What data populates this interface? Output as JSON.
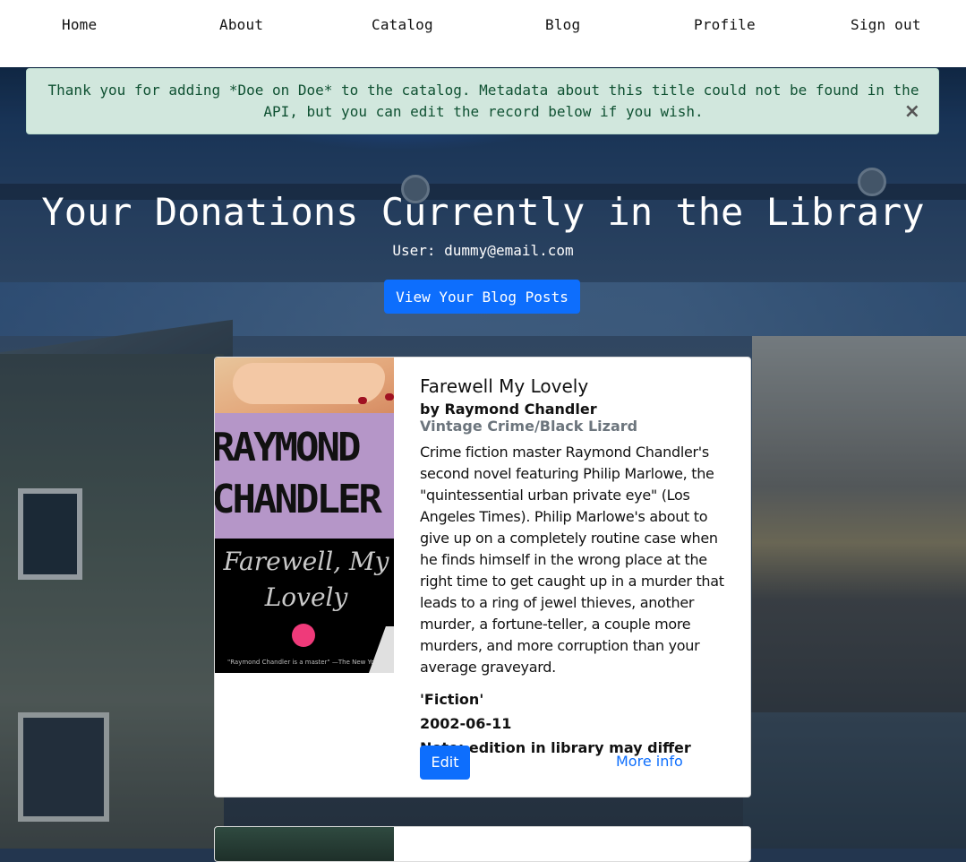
{
  "nav": {
    "items": [
      {
        "label": "Home"
      },
      {
        "label": "About"
      },
      {
        "label": "Catalog"
      },
      {
        "label": "Blog"
      },
      {
        "label": "Profile"
      },
      {
        "label": "Sign out"
      }
    ]
  },
  "alert": {
    "message": "Thank you for adding *Doe on Doe* to the catalog. Metadata about this title could not be found in the API, but you can edit the record below if you wish.",
    "close_glyph": "×"
  },
  "page": {
    "title": "Your Donations Currently in the Library",
    "user_line": "User: dummy@email.com",
    "blog_button": "View Your Blog Posts"
  },
  "books": [
    {
      "title": "Farewell My Lovely",
      "byline": "by Raymond Chandler",
      "publisher": "Vintage Crime/Black Lizard",
      "description": "Crime fiction master Raymond Chandler's second novel featuring Philip Marlowe, the \"quintessential urban private eye\" (Los Angeles Times). Philip Marlowe's about to give up on a completely routine case when he finds himself in the wrong place at the right time to get caught up in a murder that leads to a ring of jewel thieves, another murder, a fortune-teller, a couple more murders, and more corruption than your average graveyard.",
      "genre": "'Fiction'",
      "date": "2002-06-11",
      "note": "Note: edition in library may differ",
      "edit_label": "Edit",
      "more_label": "More info",
      "cover": {
        "author_line1": "RAYMOND",
        "author_line2": "CHANDLER",
        "title_line1": "Farewell, My",
        "title_line2": "Lovely",
        "quote": "\"Raymond Chandler is a master\" —The New York Times"
      }
    }
  ],
  "colors": {
    "primary": "#0d6efd",
    "alert_bg": "#d1e7dd",
    "alert_text": "#0f5132",
    "muted": "#6c757d"
  }
}
